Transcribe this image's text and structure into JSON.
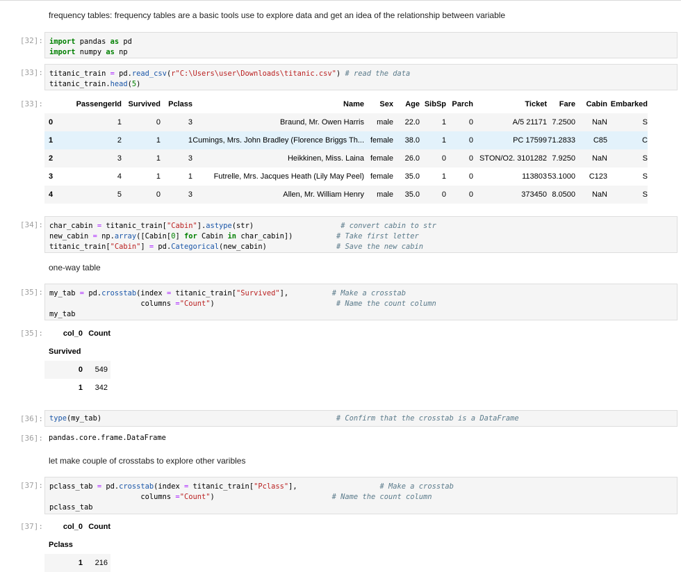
{
  "markdown": {
    "intro": "frequency tables: frequency tables are a basic tools use to explore data and get an idea of the relationship between variable",
    "one_way": "one-way table",
    "more": "let make couple of crosstabs to explore other varibles"
  },
  "prompts": {
    "in32": "[32]:",
    "in33": "[33]:",
    "out33": "[33]:",
    "in34": "[34]:",
    "in35": "[35]:",
    "out35": "[35]:",
    "in36": "[36]:",
    "out36": "[36]:",
    "in37": "[37]:",
    "out37": "[37]:"
  },
  "code": {
    "c32": [
      "import pandas as pd",
      "import numpy as np"
    ],
    "c33": [
      "titanic_train = pd.read_csv(r\"C:\\Users\\user\\Downloads\\titanic.csv\") # read the data",
      "titanic_train.head(5)"
    ],
    "c34": [
      "char_cabin = titanic_train[\"Cabin\"].astype(str)                    # convert cabin to str",
      "new_cabin = np.array([Cabin[0] for Cabin in char_cabin])          # Take first letter",
      "titanic_train[\"Cabin\"] = pd.Categorical(new_cabin)                # Save the new cabin"
    ],
    "c35": [
      "my_tab = pd.crosstab(index = titanic_train[\"Survived\"],          # Make a crosstab",
      "                     columns =\"Count\")                            # Name the count column",
      "my_tab"
    ],
    "c36": [
      "type(my_tab)                                                      # Confirm that the crosstab is a DataFrame"
    ],
    "c37": [
      "pclass_tab = pd.crosstab(index = titanic_train[\"Pclass\"],                   # Make a crosstab",
      "                     columns =\"Count\")                           # Name the count column",
      "pclass_tab"
    ]
  },
  "head_table": {
    "columns": [
      "",
      "PassengerId",
      "Survived",
      "Pclass",
      "Name",
      "Sex",
      "Age",
      "SibSp",
      "Parch",
      "Ticket",
      "Fare",
      "Cabin",
      "Embarked"
    ],
    "rows": [
      [
        "0",
        "1",
        "0",
        "3",
        "Braund, Mr. Owen Harris",
        "male",
        "22.0",
        "1",
        "0",
        "A/5 21171",
        "7.2500",
        "NaN",
        "S"
      ],
      [
        "1",
        "2",
        "1",
        "1",
        "Cumings, Mrs. John Bradley (Florence Briggs Th...",
        "female",
        "38.0",
        "1",
        "0",
        "PC 17599",
        "71.2833",
        "C85",
        "C"
      ],
      [
        "2",
        "3",
        "1",
        "3",
        "Heikkinen, Miss. Laina",
        "female",
        "26.0",
        "0",
        "0",
        "STON/O2. 3101282",
        "7.9250",
        "NaN",
        "S"
      ],
      [
        "3",
        "4",
        "1",
        "1",
        "Futrelle, Mrs. Jacques Heath (Lily May Peel)",
        "female",
        "35.0",
        "1",
        "0",
        "113803",
        "53.1000",
        "C123",
        "S"
      ],
      [
        "4",
        "5",
        "0",
        "3",
        "Allen, Mr. William Henry",
        "male",
        "35.0",
        "0",
        "0",
        "373450",
        "8.0500",
        "NaN",
        "S"
      ]
    ]
  },
  "survived_table": {
    "col_label": "col_0",
    "count_label": "Count",
    "index_label": "Survived",
    "rows": [
      [
        "0",
        "549"
      ],
      [
        "1",
        "342"
      ]
    ]
  },
  "type_output": "pandas.core.frame.DataFrame",
  "pclass_table": {
    "col_label": "col_0",
    "count_label": "Count",
    "index_label": "Pclass",
    "rows": [
      [
        "1",
        "216"
      ]
    ]
  }
}
